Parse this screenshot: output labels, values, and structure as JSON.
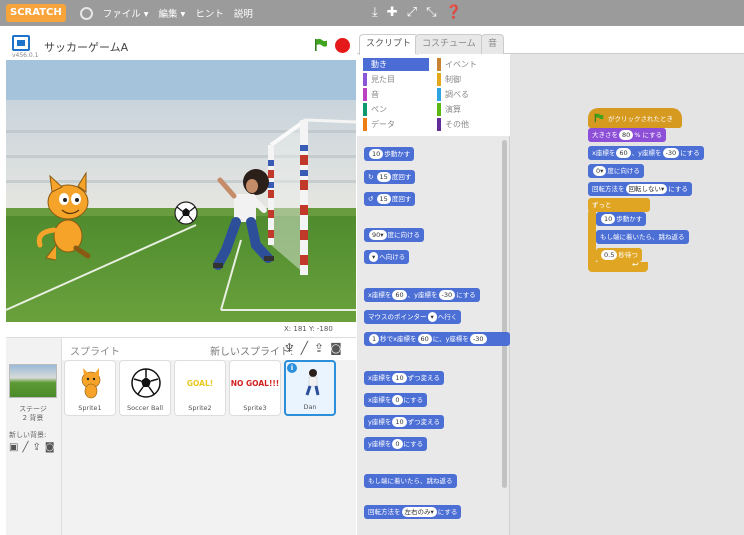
{
  "menu": {
    "logo": "SCRATCH",
    "items": [
      "ファイル ▾",
      "編集 ▾",
      "ヒント",
      "説明"
    ],
    "tools": [
      "duplicate-icon",
      "delete-icon",
      "grow-icon",
      "shrink-icon",
      "help-icon"
    ]
  },
  "stage": {
    "version": "v456.0.1",
    "title": "サッカーゲームA",
    "coords": "X: 181  Y: -180"
  },
  "sprites": {
    "header": "スプライト",
    "new_sprite": "新しいスプライト:",
    "stage_label": "ステージ\n2 背景",
    "new_backdrop": "新しい背景:",
    "items": [
      {
        "name": "Sprite1"
      },
      {
        "name": "Soccer Ball"
      },
      {
        "name": "Sprite2",
        "text": "GOAL!"
      },
      {
        "name": "Sprite3",
        "text": "NO GOAL!!!"
      },
      {
        "name": "Dan"
      }
    ]
  },
  "tabs": [
    "スクリプト",
    "コスチューム",
    "音"
  ],
  "categories": {
    "left": [
      {
        "label": "動き",
        "color": "#4a6cd4"
      },
      {
        "label": "見た目",
        "color": "#8a55d7"
      },
      {
        "label": "音",
        "color": "#bb42c3"
      },
      {
        "label": "ペン",
        "color": "#0e9a6c"
      },
      {
        "label": "データ",
        "color": "#ee7d16"
      }
    ],
    "right": [
      {
        "label": "イベント",
        "color": "#c88330"
      },
      {
        "label": "制御",
        "color": "#e1a91a"
      },
      {
        "label": "調べる",
        "color": "#2ca5e2"
      },
      {
        "label": "演算",
        "color": "#5cb712"
      },
      {
        "label": "その他",
        "color": "#632d99"
      }
    ]
  },
  "palette": {
    "move": {
      "pre": "",
      "val": "10",
      "post": "歩動かす"
    },
    "turn_right": {
      "val": "15",
      "post": "度回す"
    },
    "turn_left": {
      "val": "15",
      "post": "度回す"
    },
    "point_dir": {
      "val": "90▾",
      "post": "度に向ける"
    },
    "point_towards": {
      "val": "▾",
      "post": "へ向ける"
    },
    "goto_xy": {
      "a": "x座標を",
      "x": "60",
      "b": "、y座標を",
      "y": "-30",
      "c": "にする"
    },
    "goto_mouse": {
      "pre": "マウスのポインター",
      "post": "へ行く"
    },
    "glide": {
      "secs": "1",
      "a": "秒でx座標を",
      "x": "60",
      "b": "に、y座標を",
      "y": "-30"
    },
    "change_x": {
      "a": "x座標を",
      "val": "10",
      "b": "ずつ変える"
    },
    "set_x": {
      "a": "x座標を",
      "val": "0",
      "b": "にする"
    },
    "change_y": {
      "a": "y座標を",
      "val": "10",
      "b": "ずつ変える"
    },
    "set_y": {
      "a": "y座標を",
      "val": "0",
      "b": "にする"
    },
    "bounce": "もし端に着いたら、跳ね返る",
    "rotation_style": {
      "a": "回転方法を",
      "val": "左右のみ▾",
      "b": "にする"
    }
  },
  "script": {
    "hat": "がクリックされたとき",
    "size": {
      "a": "大きさを",
      "val": "80",
      "b": "% にする"
    },
    "goto": {
      "a": "x座標を",
      "x": "60",
      "b": "、y座標を",
      "y": "-30",
      "c": "にする"
    },
    "dir": {
      "val": "0▾",
      "b": "度に向ける"
    },
    "rot": {
      "a": "回転方法を",
      "val": "回転しない▾",
      "b": "にする"
    },
    "forever": "ずっと",
    "move": {
      "val": "10",
      "b": "歩動かす"
    },
    "bounce": "もし端に着いたら、跳ね返る",
    "wait": {
      "val": "0.5",
      "b": "秒待つ"
    }
  }
}
